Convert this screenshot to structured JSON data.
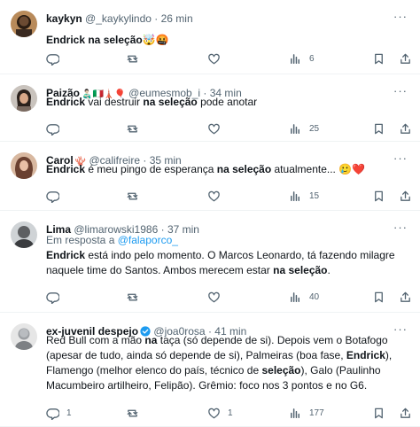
{
  "tweets": [
    {
      "name": "kaykyn",
      "handle": "@_kaykylindo",
      "dot": "·",
      "time": "26 min",
      "name_emoji": "",
      "verified": false,
      "reply_prefix": "",
      "reply_handle": "",
      "segments": [
        {
          "t": "Endrick",
          "b": true
        },
        {
          "t": " na seleção",
          "b": true
        },
        {
          "t": "🤯🤬",
          "b": false
        }
      ],
      "replies": "",
      "retweets": "",
      "likes": "",
      "views": "6"
    },
    {
      "name": "Paizão",
      "handle": "@eumesmob_i",
      "dot": "·",
      "time": "34 min",
      "name_emoji": "👨🏻‍🍼🇮🇹🗼🎈",
      "verified": false,
      "reply_prefix": "",
      "reply_handle": "",
      "segments": [
        {
          "t": "Endrick",
          "b": true
        },
        {
          "t": " vai destruir ",
          "b": false
        },
        {
          "t": "na seleção",
          "b": true
        },
        {
          "t": " pode anotar",
          "b": false
        }
      ],
      "replies": "",
      "retweets": "",
      "likes": "",
      "views": "25"
    },
    {
      "name": "Carol",
      "handle": "@califreire",
      "dot": "·",
      "time": "35 min",
      "name_emoji": "🪸",
      "verified": false,
      "reply_prefix": "",
      "reply_handle": "",
      "segments": [
        {
          "t": "Endrick",
          "b": true
        },
        {
          "t": " é meu pingo de esperança ",
          "b": false
        },
        {
          "t": "na seleção",
          "b": true
        },
        {
          "t": " atualmente... 🥲❤️",
          "b": false
        }
      ],
      "replies": "",
      "retweets": "",
      "likes": "",
      "views": "15"
    },
    {
      "name": "Lima",
      "handle": "@limarowski1986",
      "dot": "·",
      "time": "37 min",
      "name_emoji": "",
      "verified": false,
      "reply_prefix": "Em resposta a ",
      "reply_handle": "@falaporco_",
      "segments": [
        {
          "t": "Endrick",
          "b": true
        },
        {
          "t": " está indo pelo momento. O Marcos Leonardo, tá fazendo milagre naquele time do Santos. Ambos merecem estar ",
          "b": false
        },
        {
          "t": "na seleção",
          "b": true
        },
        {
          "t": ".",
          "b": false
        }
      ],
      "replies": "",
      "retweets": "",
      "likes": "",
      "views": "40"
    },
    {
      "name": "ex-juvenil despejo",
      "handle": "@joa0rosa",
      "dot": "·",
      "time": "41 min",
      "name_emoji": "",
      "verified": true,
      "reply_prefix": "",
      "reply_handle": "",
      "segments": [
        {
          "t": "Red Bull com a mão ",
          "b": false
        },
        {
          "t": "na",
          "b": true
        },
        {
          "t": " taça (só depende de si). Depois vem o Botafogo (apesar de tudo, ainda só depende de si), Palmeiras (boa fase, ",
          "b": false
        },
        {
          "t": "Endrick",
          "b": true
        },
        {
          "t": "), Flamengo (melhor elenco do país, técnico de ",
          "b": false
        },
        {
          "t": "seleção",
          "b": true
        },
        {
          "t": "), Galo (Paulinho Macumbeiro artilheiro, Felipão). Grêmio: foco nos 3 pontos e no G6.",
          "b": false
        }
      ],
      "replies": "1",
      "retweets": "",
      "likes": "1",
      "views": "177"
    }
  ],
  "ui": {
    "more_icon": "more-dots-icon",
    "reply_icon": "reply-icon",
    "retweet_icon": "retweet-icon",
    "like_icon": "heart-icon",
    "views_icon": "views-icon",
    "bookmark_icon": "bookmark-icon",
    "share_icon": "share-icon",
    "more_glyph": "···",
    "accent": "#1d9bf0",
    "muted": "#536471"
  }
}
